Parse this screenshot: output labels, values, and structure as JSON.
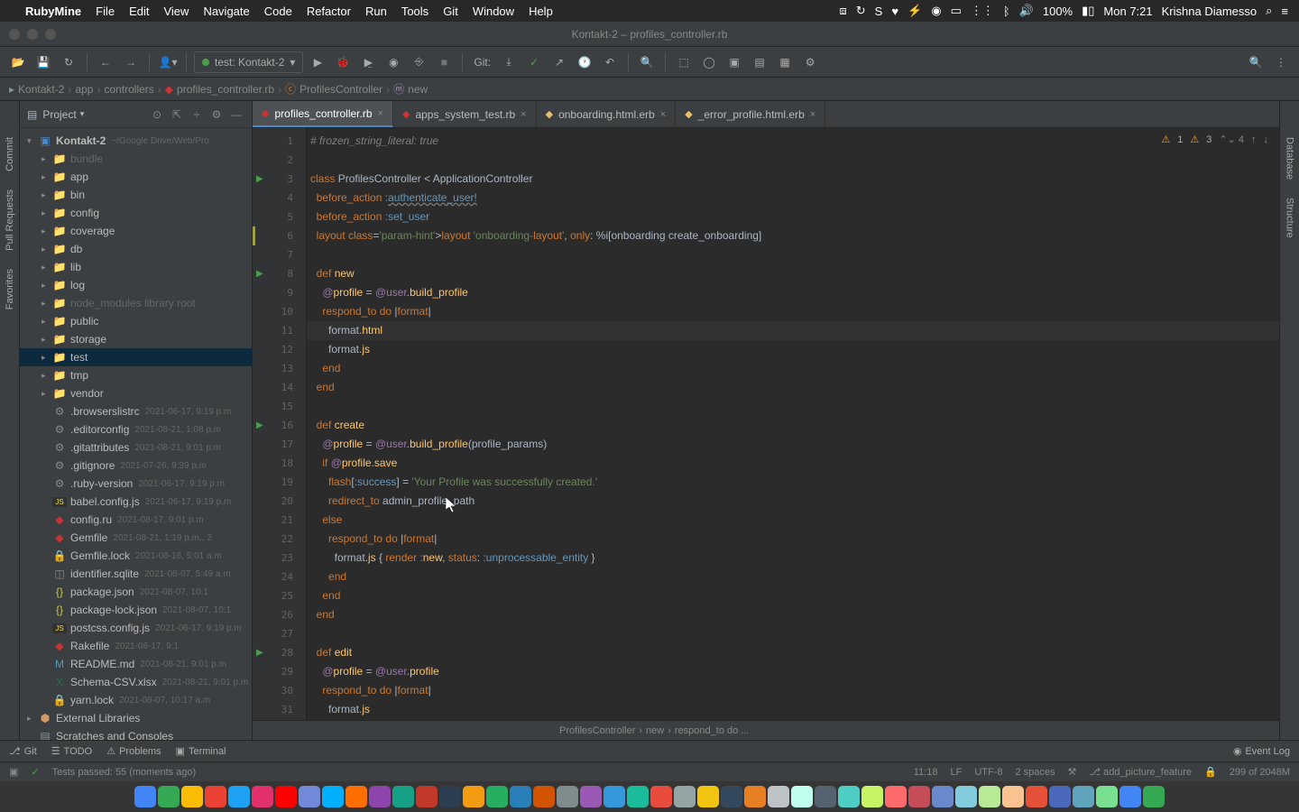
{
  "menubar": {
    "apple": "",
    "app": "RubyMine",
    "items": [
      "File",
      "Edit",
      "View",
      "Navigate",
      "Code",
      "Refactor",
      "Run",
      "Tools",
      "Git",
      "Window",
      "Help"
    ],
    "battery": "100%",
    "clock": "Mon 7:21",
    "user": "Krishna Diamesso"
  },
  "titlebar": {
    "title": "Kontakt-2 – profiles_controller.rb"
  },
  "toolbar": {
    "run_config": "test: Kontakt-2",
    "git_label": "Git:"
  },
  "navbar": {
    "crumbs": [
      "Kontakt-2",
      "app",
      "controllers",
      "profiles_controller.rb",
      "ProfilesController",
      "new"
    ]
  },
  "project": {
    "header": "Project",
    "root": "Kontakt-2",
    "root_path": "~/Google Drive/Web/Pro",
    "folders": [
      {
        "name": "bundle",
        "dim": true
      },
      {
        "name": "app"
      },
      {
        "name": "bin"
      },
      {
        "name": "config"
      },
      {
        "name": "coverage"
      },
      {
        "name": "db"
      },
      {
        "name": "lib"
      },
      {
        "name": "log"
      },
      {
        "name": "node_modules",
        "dim": true,
        "suffix": "library root"
      },
      {
        "name": "public"
      },
      {
        "name": "storage"
      },
      {
        "name": "test",
        "selected": true
      },
      {
        "name": "tmp"
      },
      {
        "name": "vendor"
      }
    ],
    "files": [
      {
        "name": ".browserslistrc",
        "date": "2021-06-17, 9:19 p.m"
      },
      {
        "name": ".editorconfig",
        "date": "2021-08-21, 1:08 p.m"
      },
      {
        "name": ".gitattributes",
        "date": "2021-08-21, 9:01 p.m"
      },
      {
        "name": ".gitignore",
        "date": "2021-07-26, 9:39 p.m"
      },
      {
        "name": ".ruby-version",
        "date": "2021-06-17, 9:19 p.m"
      },
      {
        "name": "babel.config.js",
        "date": "2021-06-17, 9:19 p.m"
      },
      {
        "name": "config.ru",
        "date": "2021-08-17, 9:01 p.m"
      },
      {
        "name": "Gemfile",
        "date": "2021-08-21, 1:19 p.m., 2"
      },
      {
        "name": "Gemfile.lock",
        "date": "2021-08-16, 5:01 a.m"
      },
      {
        "name": "identifier.sqlite",
        "date": "2021-08-07, 5:49 a.m"
      },
      {
        "name": "package.json",
        "date": "2021-08-07, 10:1"
      },
      {
        "name": "package-lock.json",
        "date": "2021-08-07, 10:1"
      },
      {
        "name": "postcss.config.js",
        "date": "2021-06-17, 9:19 p.m"
      },
      {
        "name": "Rakefile",
        "date": "2021-06-17, 9:1"
      },
      {
        "name": "README.md",
        "date": "2021-08-21, 9:01 p.m"
      },
      {
        "name": "Schema-CSV.xlsx",
        "date": "2021-08-21, 9:01 p.m"
      },
      {
        "name": "yarn.lock",
        "date": "2021-08-07, 10:17 a.m"
      }
    ],
    "ext1": "External Libraries",
    "ext2": "Scratches and Consoles"
  },
  "tabs": [
    {
      "name": "profiles_controller.rb",
      "type": "rb",
      "active": true
    },
    {
      "name": "apps_system_test.rb",
      "type": "rb"
    },
    {
      "name": "onboarding.html.erb",
      "type": "erb"
    },
    {
      "name": "_error_profile.html.erb",
      "type": "erb"
    }
  ],
  "inspections": {
    "w1": "1",
    "w2": "3",
    "nav": "4"
  },
  "editor_crumb": [
    "ProfilesController",
    "new",
    "respond_to do ..."
  ],
  "bottom_tools": {
    "git": "Git",
    "todo": "TODO",
    "problems": "Problems",
    "terminal": "Terminal",
    "event_log": "Event Log"
  },
  "status": {
    "tests": "Tests passed: 55 (moments ago)",
    "pos": "11:18",
    "lf": "LF",
    "enc": "UTF-8",
    "indent": "2 spaces",
    "branch": "add_picture_feature",
    "mem": "299 of 2048M"
  },
  "side_tabs": {
    "left": [
      "Commit",
      "Pull Requests",
      "Favorites"
    ],
    "right": [
      "Database",
      "Structure"
    ]
  },
  "code_lines": [
    "# frozen_string_literal: true",
    "",
    "class ProfilesController < ApplicationController",
    "  before_action :authenticate_user!",
    "  before_action :set_user",
    "  layout 'onboarding-layout', only: %i[onboarding create_onboarding]",
    "",
    "  def new",
    "    @profile = @user.build_profile",
    "    respond_to do |format|",
    "      format.html",
    "      format.js",
    "    end",
    "  end",
    "",
    "  def create",
    "    @profile = @user.build_profile(profile_params)",
    "    if @profile.save",
    "      flash[:success] = 'Your Profile was successfully created.'",
    "      redirect_to admin_profile_path",
    "    else",
    "      respond_to do |format|",
    "        format.js { render :new, status: :unprocessable_entity }",
    "      end",
    "    end",
    "  end",
    "",
    "  def edit",
    "    @profile = @user.profile",
    "    respond_to do |format|",
    "      format.js"
  ]
}
